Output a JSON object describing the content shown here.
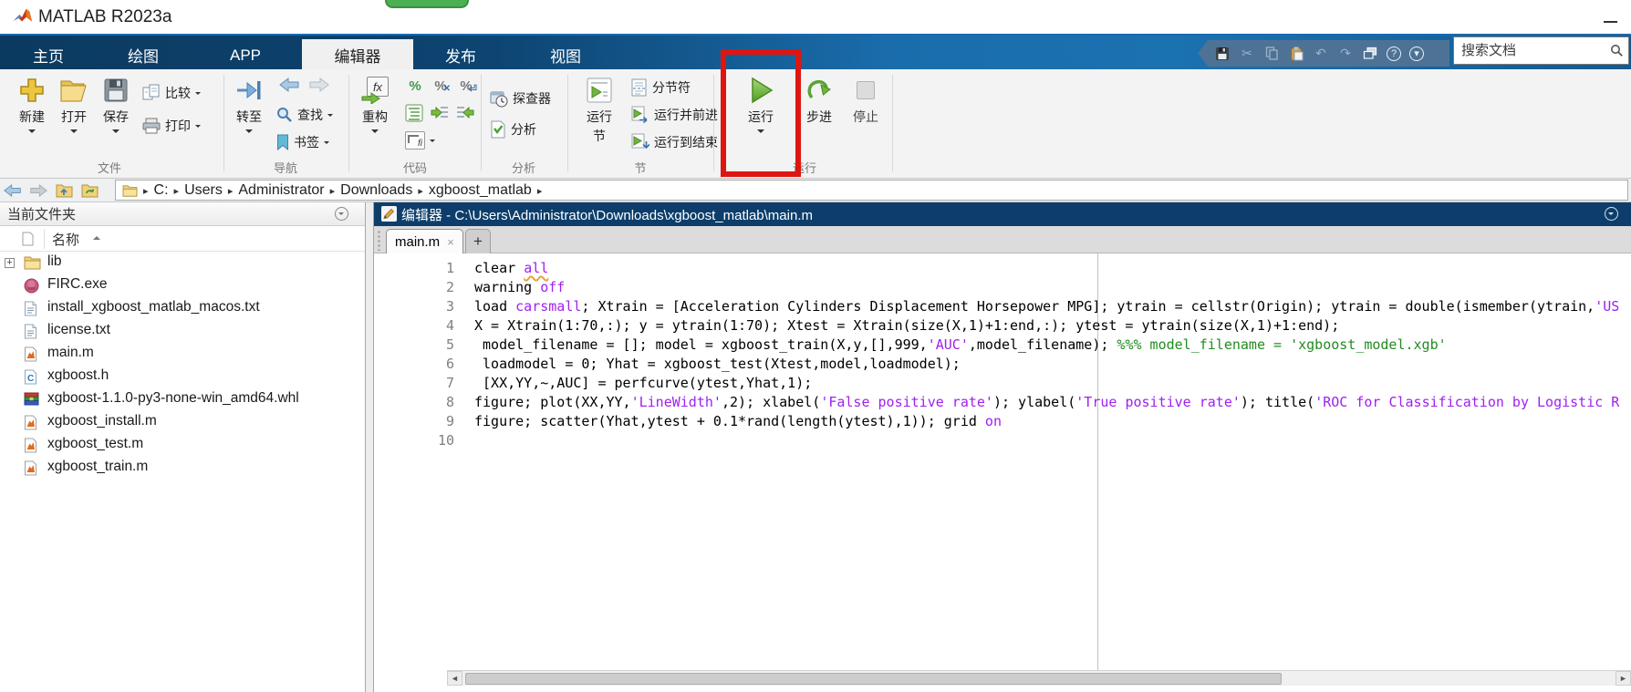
{
  "titlebar": {
    "app_title": "MATLAB R2023a"
  },
  "colors": {
    "annotation_red": "#dd1612",
    "string_purple": "#a020f0",
    "comment_green": "#228b22",
    "ribbon_navy": "#0b3a60",
    "run_green": "#5aa336"
  },
  "ribbon": {
    "tabs": [
      {
        "id": "home",
        "label": "主页",
        "active": false
      },
      {
        "id": "plots",
        "label": "绘图",
        "active": false
      },
      {
        "id": "apps",
        "label": "APP",
        "active": false
      },
      {
        "id": "editor",
        "label": "编辑器",
        "active": true
      },
      {
        "id": "publish",
        "label": "发布",
        "active": false
      },
      {
        "id": "view",
        "label": "视图",
        "active": false
      }
    ],
    "search_placeholder": "搜索文档",
    "buttons": {
      "new": "新建",
      "open": "打开",
      "save": "保存",
      "compare": "比较",
      "print": "打印",
      "goto": "转至",
      "find": "查找",
      "bookmark": "书签",
      "refactor": "重构",
      "profiler": "探查器",
      "analyze": "分析",
      "run_section_l1": "运行",
      "run_section_l2": "节",
      "section_break": "分节符",
      "run_advance": "运行并前进",
      "run_to_end": "运行到结束",
      "run": "运行",
      "step": "步进",
      "stop": "停止"
    },
    "group_labels": {
      "file": "文件",
      "nav": "导航",
      "code": "代码",
      "analysis": "分析",
      "section": "节",
      "run": "运行"
    },
    "icon_glyphs": {
      "fx": "fx",
      "percent": "%",
      "fi": "fi",
      "help": "?"
    }
  },
  "address_bar": {
    "segments": [
      "C:",
      "Users",
      "Administrator",
      "Downloads",
      "xgboost_matlab"
    ]
  },
  "file_panel": {
    "title": "当前文件夹",
    "column_header": "名称",
    "h_letter": "C",
    "files": [
      {
        "name": "lib",
        "icon": "folder",
        "expandable": true
      },
      {
        "name": "FIRC.exe",
        "icon": "exe"
      },
      {
        "name": "install_xgboost_matlab_macos.txt",
        "icon": "txt"
      },
      {
        "name": "license.txt",
        "icon": "txt"
      },
      {
        "name": "main.m",
        "icon": "mfile"
      },
      {
        "name": "xgboost.h",
        "icon": "hfile"
      },
      {
        "name": "xgboost-1.1.0-py3-none-win_amd64.whl",
        "icon": "whl"
      },
      {
        "name": "xgboost_install.m",
        "icon": "mfile"
      },
      {
        "name": "xgboost_test.m",
        "icon": "mfile"
      },
      {
        "name": "xgboost_train.m",
        "icon": "mfile"
      }
    ]
  },
  "editor": {
    "title": "编辑器 - C:\\Users\\Administrator\\Downloads\\xgboost_matlab\\main.m",
    "tab_label": "main.m",
    "close_glyph": "×",
    "new_tab_glyph": "+",
    "lines": [
      {
        "n": "1",
        "segs": [
          [
            "clear ",
            "k"
          ],
          [
            "all",
            "w"
          ]
        ]
      },
      {
        "n": "2",
        "segs": [
          [
            "warning ",
            "k"
          ],
          [
            "off",
            "s"
          ]
        ]
      },
      {
        "n": "3",
        "segs": [
          [
            "load ",
            "k"
          ],
          [
            "carsmall",
            "s"
          ],
          [
            "; Xtrain = [Acceleration Cylinders Displacement Horsepower MPG]; ytrain = cellstr(Origin); ytrain = double(ismember(ytrain,",
            "k"
          ],
          [
            "'US",
            "s"
          ]
        ]
      },
      {
        "n": "4",
        "segs": [
          [
            "X = Xtrain(1:70,:); y = ytrain(1:70); Xtest = Xtrain(size(X,1)+1:end,:); ytest = ytrain(size(X,1)+1:end);",
            "k"
          ]
        ]
      },
      {
        "n": "5",
        "segs": [
          [
            " model_filename = []; model = xgboost_train(X,y,[],999,",
            "k"
          ],
          [
            "'AUC'",
            "s"
          ],
          [
            ",model_filename); ",
            "k"
          ],
          [
            "%%% model_filename = 'xgboost_model.xgb'",
            "c"
          ]
        ]
      },
      {
        "n": "6",
        "segs": [
          [
            " loadmodel = 0; Yhat = xgboost_test(Xtest,model,loadmodel);",
            "k"
          ]
        ]
      },
      {
        "n": "7",
        "segs": [
          [
            " [XX,YY,~,AUC] = perfcurve(ytest,Yhat,1);",
            "k"
          ]
        ]
      },
      {
        "n": "8",
        "segs": [
          [
            "figure; plot(XX,YY,",
            "k"
          ],
          [
            "'LineWidth'",
            "s"
          ],
          [
            ",2); xlabel(",
            "k"
          ],
          [
            "'False positive rate'",
            "s"
          ],
          [
            "); ylabel(",
            "k"
          ],
          [
            "'True positive rate'",
            "s"
          ],
          [
            "); title(",
            "k"
          ],
          [
            "'ROC for Classification by Logistic R",
            "s"
          ]
        ]
      },
      {
        "n": "9",
        "segs": [
          [
            "figure; scatter(Yhat,ytest + 0.1*rand(length(ytest),1)); grid ",
            "k"
          ],
          [
            "on",
            "s"
          ]
        ]
      },
      {
        "n": "10",
        "segs": []
      }
    ]
  }
}
